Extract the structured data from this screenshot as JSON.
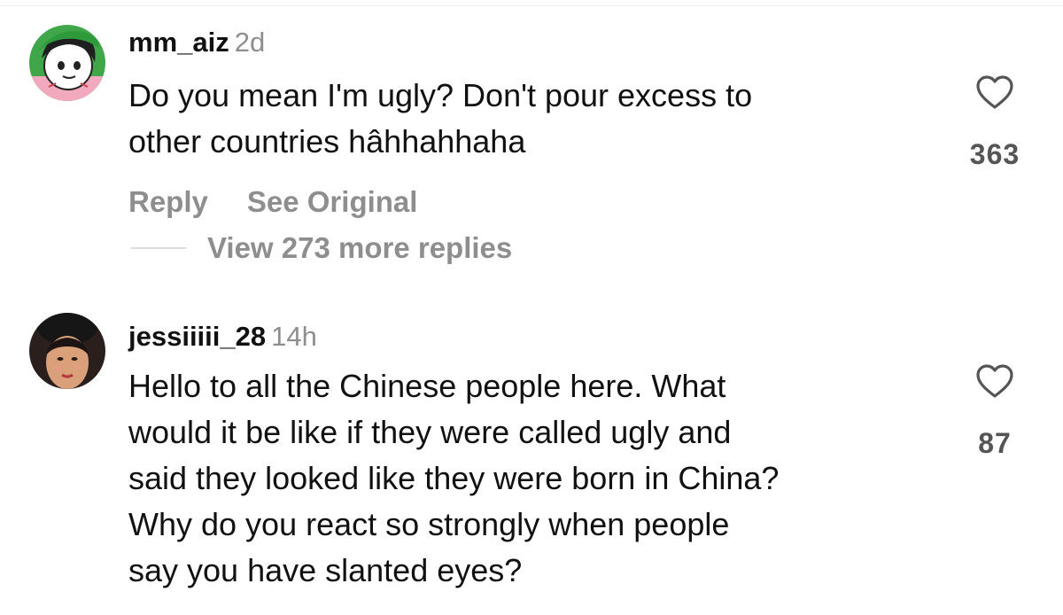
{
  "comments": [
    {
      "username": "mm_aiz",
      "time": "2d",
      "text_lines": [
        "Do you mean I'm ugly? Don't pour excess to",
        "other countries hâhhahhaha"
      ],
      "reply_label": "Reply",
      "see_original_label": "See Original",
      "view_replies_label": "View 273 more replies",
      "likes": "363",
      "avatar_icon": "cartoon-avatar"
    },
    {
      "username": "jessiiiii_28",
      "time": "14h",
      "text_lines": [
        "Hello to all the Chinese people here. What",
        "would it be like if they were called ugly and",
        "said they looked like they were born in China?",
        "Why do you react so strongly when people",
        "say you have slanted eyes?"
      ],
      "likes": "87",
      "avatar_icon": "photo-avatar"
    }
  ],
  "colors": {
    "text": "#111111",
    "secondary": "#8e8e8e",
    "divider": "#dbdbdb"
  }
}
